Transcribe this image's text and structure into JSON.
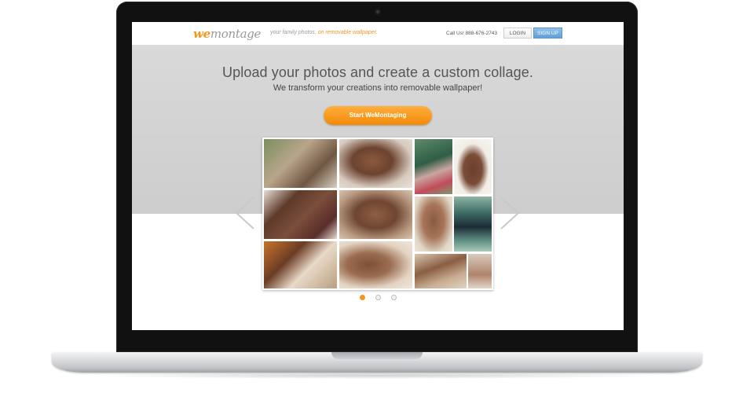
{
  "site": {
    "logo_prefix": "we",
    "logo_suffix": "montage",
    "tagline_start": "your family photos.",
    "tagline_highlight": "on removable wallpaper.",
    "call": "Call Us! 888-676-2743",
    "login_label": "LOGIN",
    "signup_label": "SIGN UP"
  },
  "hero": {
    "title": "Upload your photos and create a custom collage.",
    "subtitle": "We transform your creations into removable wallpaper!",
    "cta_label": "Start WeMontaging"
  },
  "carousel": {
    "slide_count": 3,
    "active_slide": 1
  },
  "colors": {
    "brand_orange": "#f7941d",
    "signup_blue": "#6aa8dc",
    "hero_gray": "#d3d3d3"
  },
  "icons": {
    "prev": "chevron-left-icon",
    "next": "chevron-right-icon",
    "camera": "webcam-icon"
  }
}
